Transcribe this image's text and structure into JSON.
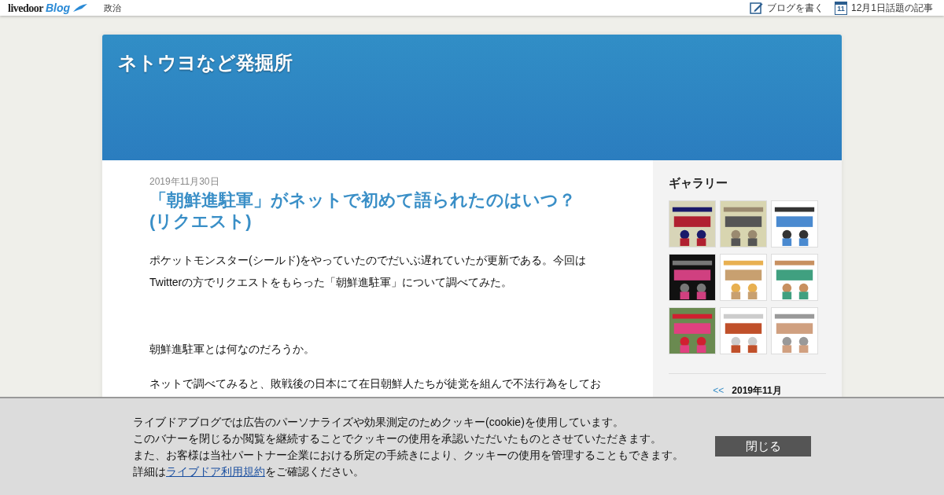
{
  "topbar": {
    "logo": "livedoor",
    "logo_sub": "Blog",
    "category": "政治",
    "links": [
      {
        "kind": "write",
        "label": "ブログを書く"
      },
      {
        "kind": "calendar",
        "label": "12月1日話題の記事",
        "day": "11"
      }
    ]
  },
  "blog": {
    "title": "ネトウヨなど発掘所"
  },
  "article": {
    "date": "2019年11月30日",
    "title": "「朝鮮進駐軍」がネットで初めて語られたのはいつ？(リクエスト)",
    "paragraphs": [
      "ポケットモンスター(シールド)をやっていたのでだいぶ遅れていたが更新である。今回はTwitterの方でリクエストをもらった「朝鮮進駐軍」について調べてみた。",
      "朝鮮進駐軍とは何なのだろうか。",
      "ネットで調べてみると、敗戦後の日本にて在日朝鮮人たちが徒党を組んで不法行為をしてお"
    ]
  },
  "sidebar": {
    "gallery_title": "ギャラリー",
    "calendar": {
      "prev": "<<",
      "month": "2019年11月"
    }
  },
  "cookie_banner": {
    "lines": [
      "ライブドアブログでは広告のパーソナライズや効果測定のためクッキー(cookie)を使用しています。",
      "このバナーを閉じるか閲覧を継続することでクッキーの使用を承認いただいたものとさせていただきます。",
      "また、お客様は当社パートナー企業における所定の手続きにより、クッキーの使用を管理することもできます。"
    ],
    "last_line": {
      "before": "詳細は",
      "link": "ライブドア利用規約",
      "after": "をご確認ください。"
    },
    "close": "閉じる"
  }
}
